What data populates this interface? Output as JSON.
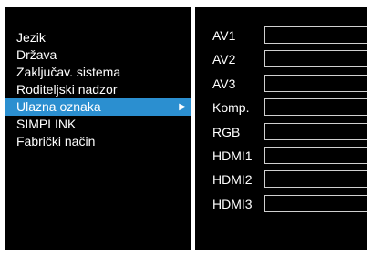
{
  "menu": {
    "items": [
      {
        "label": "Jezik"
      },
      {
        "label": "Država"
      },
      {
        "label": "Zaključav. sistema"
      },
      {
        "label": "Roditeljski nadzor"
      },
      {
        "label": "Ulazna oznaka",
        "selected": true,
        "arrow": "▶"
      },
      {
        "label": "SIMPLINK"
      },
      {
        "label": "Fabrički način"
      }
    ]
  },
  "inputs": {
    "rows": [
      {
        "label": "AV1",
        "value": ""
      },
      {
        "label": "AV2",
        "value": ""
      },
      {
        "label": "AV3",
        "value": ""
      },
      {
        "label": "Komp.",
        "value": ""
      },
      {
        "label": "RGB",
        "value": ""
      },
      {
        "label": "HDMI1",
        "value": ""
      },
      {
        "label": "HDMI2",
        "value": ""
      },
      {
        "label": "HDMI3",
        "value": ""
      }
    ]
  },
  "colors": {
    "selection": "#2b8fd0",
    "panel": "#000000",
    "text": "#ffffff"
  }
}
